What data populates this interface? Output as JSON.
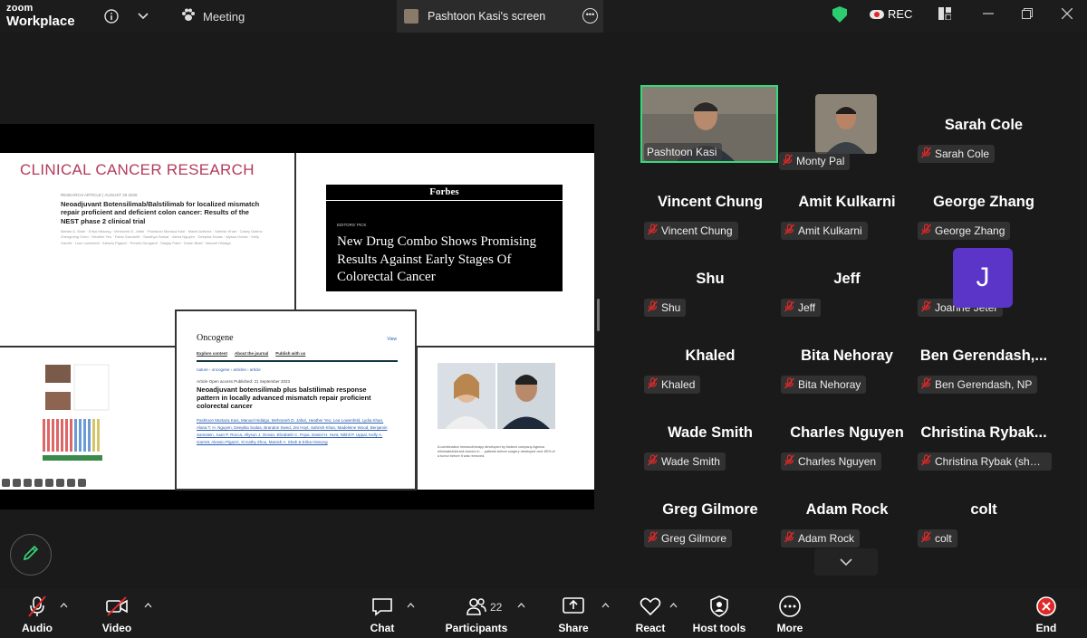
{
  "app": {
    "brand_top": "zoom",
    "brand_bottom": "Workplace"
  },
  "titlebar": {
    "meeting_label": "Meeting",
    "screen_tab_label": "Pashtoon Kasi's screen",
    "rec_label": "REC"
  },
  "shared_screen": {
    "ccr": {
      "title": "CLINICAL CANCER RESEARCH",
      "kicker": "RESEARCH ARTICLE | AUGUST 26 2026",
      "headline": "Neoadjuvant Botensilimab/Balstilimab for localized mismatch repair proficient and deficient colon cancer: Results of the NEST phase 2 clinical trial",
      "authors": "Marian A. Shah · Erika Hissong · Mehrareh D. Jafari · Pashtoon Murtaza Kasi · Madel Azbicka · Sahrish Khan · Casey Ostera · Zhengming Chen · Heather Yeo · Fabio Sacchetti · Sandhya Sarkar · Alena Nguyen · Deepika Sodas · Alyssa Ocean · Kelly Garrett · Lisa Lowenfeld · Alessio Pigazzi · Prestin Gungardi · Sanjay Patel · Dolan Basti · Manuel Hidalgo"
    },
    "forbes": {
      "logo": "Forbes",
      "pick": "EDITORS' PICK",
      "headline": "New Drug Combo Shows Promising Results Against Early Stages Of Colorectal Cancer"
    },
    "oncogene": {
      "logo": "Oncogene",
      "view": "View",
      "nav": [
        "Explore content",
        "About the journal",
        "Publish with us"
      ],
      "breadcrumb": "nature › oncogene › articles › article",
      "meta": "Article  Open access  Published: 21 September 2023",
      "headline": "Neoadjuvant botensilimab plus balstilimab response pattern in locally advanced mismatch repair proficient colorectal cancer",
      "authors": "Pashtoon Murtaza Kasi, Manuel Hidalgo, Mehraneh D. Jafari, Heather Yeo, Lea Lowenfeld, Lydia Khan, Alana T. H. Nguyen, Deepika Sodas, Brandon Swed, Jini Hoyt, Sahrish Khan, Madeleine Wood, Benjamin Samstein, Juan P. Rocca, Allyson J. Ocean, Elizabeth C. Popa, Daniel H. Hunt, Nikhil P. Uppal, Kelly A. Garrett, Alessio Pigazzi, Xi Kathy Zhou, Manish A. Shah & Erika Hissong"
    },
    "photo_caption": "A combination immunotherapy developed by biotech company Agenus eliminated/shrank tumors in ... patients before surgery destroyed over 80% of a tumor before it was removed."
  },
  "participants_gallery": [
    {
      "big_name": "",
      "label": "Pashtoon Kasi",
      "muted": false,
      "video": true,
      "active": true
    },
    {
      "big_name": "",
      "label": "Monty Pal",
      "muted": true,
      "video": true,
      "active": false
    },
    {
      "big_name": "Sarah Cole",
      "label": "Sarah Cole",
      "muted": true,
      "video": false
    },
    {
      "big_name": "Vincent Chung",
      "label": "Vincent Chung",
      "muted": true,
      "video": false
    },
    {
      "big_name": "Amit Kulkarni",
      "label": "Amit Kulkarni",
      "muted": true,
      "video": false
    },
    {
      "big_name": "George Zhang",
      "label": "George Zhang",
      "muted": true,
      "video": false
    },
    {
      "big_name": "Shu",
      "label": "Shu",
      "muted": true,
      "video": false
    },
    {
      "big_name": "Jeff",
      "label": "Jeff",
      "muted": true,
      "video": false
    },
    {
      "big_name": "",
      "label": "Joanne Jeter",
      "avatar_letter": "J",
      "muted": true,
      "video": false
    },
    {
      "big_name": "Khaled",
      "label": "Khaled",
      "muted": true,
      "video": false
    },
    {
      "big_name": "Bita Nehoray",
      "label": "Bita Nehoray",
      "muted": true,
      "video": false
    },
    {
      "big_name": "Ben  Gerendash,...",
      "label": "Ben Gerendash, NP",
      "muted": true,
      "video": false
    },
    {
      "big_name": "Wade Smith",
      "label": "Wade Smith",
      "muted": true,
      "video": false
    },
    {
      "big_name": "Charles Nguyen",
      "label": "Charles Nguyen",
      "muted": true,
      "video": false
    },
    {
      "big_name": "Christina  Rybak...",
      "label": "Christina Rybak (she/h...",
      "muted": true,
      "video": false
    },
    {
      "big_name": "Greg Gilmore",
      "label": "Greg Gilmore",
      "muted": true,
      "video": false
    },
    {
      "big_name": "Adam Rock",
      "label": "Adam Rock",
      "muted": true,
      "video": false
    },
    {
      "big_name": "colt",
      "label": "colt",
      "muted": true,
      "video": false
    }
  ],
  "toolbar": {
    "audio": "Audio",
    "video": "Video",
    "chat": "Chat",
    "participants": "Participants",
    "participants_count": "22",
    "share": "Share",
    "react": "React",
    "host_tools": "Host tools",
    "more": "More",
    "end": "End"
  },
  "colors": {
    "accent_green": "#36d97a",
    "muted_red": "#e02828",
    "end_red": "#e02828",
    "avatar_purple": "#5a35c8",
    "ccr_title": "#b43a5a"
  }
}
